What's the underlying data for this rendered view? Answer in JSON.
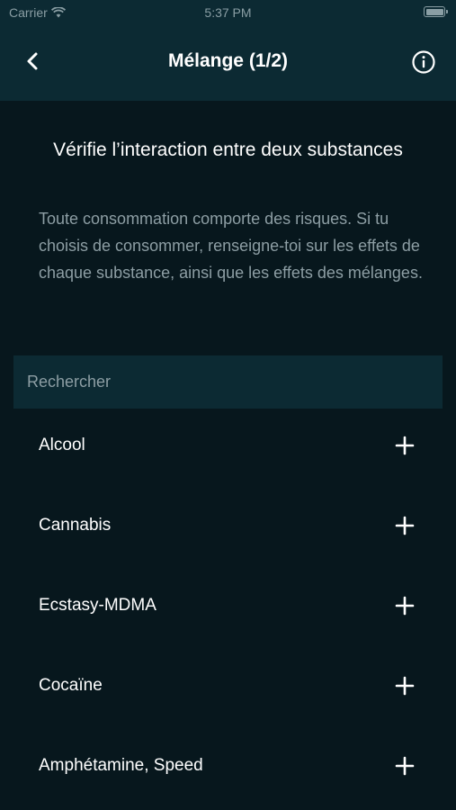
{
  "status_bar": {
    "carrier": "Carrier",
    "time": "5:37 PM",
    "icons": [
      "wifi-icon",
      "battery-icon"
    ]
  },
  "nav": {
    "title": "Mélange (1/2)",
    "back_icon": "chevron-left-icon",
    "info_icon": "info-circle-icon"
  },
  "intro": {
    "heading": "Vérifie l’interaction entre deux substances",
    "description": "Toute consommation comporte des risques. Si tu choisis de consommer, renseigne-toi sur les effets de chaque substance, ainsi que les effets des mélanges."
  },
  "search": {
    "placeholder": "Rechercher"
  },
  "substances": [
    {
      "label": "Alcool",
      "icon": "plus-icon"
    },
    {
      "label": "Cannabis",
      "icon": "plus-icon"
    },
    {
      "label": "Ecstasy-MDMA",
      "icon": "plus-icon"
    },
    {
      "label": "Cocaïne",
      "icon": "plus-icon"
    },
    {
      "label": "Amphétamine, Speed",
      "icon": "plus-icon"
    }
  ],
  "colors": {
    "background": "#07171d",
    "header": "#0c2a33",
    "text_primary": "#ffffff",
    "text_secondary": "#8d9ea4"
  }
}
